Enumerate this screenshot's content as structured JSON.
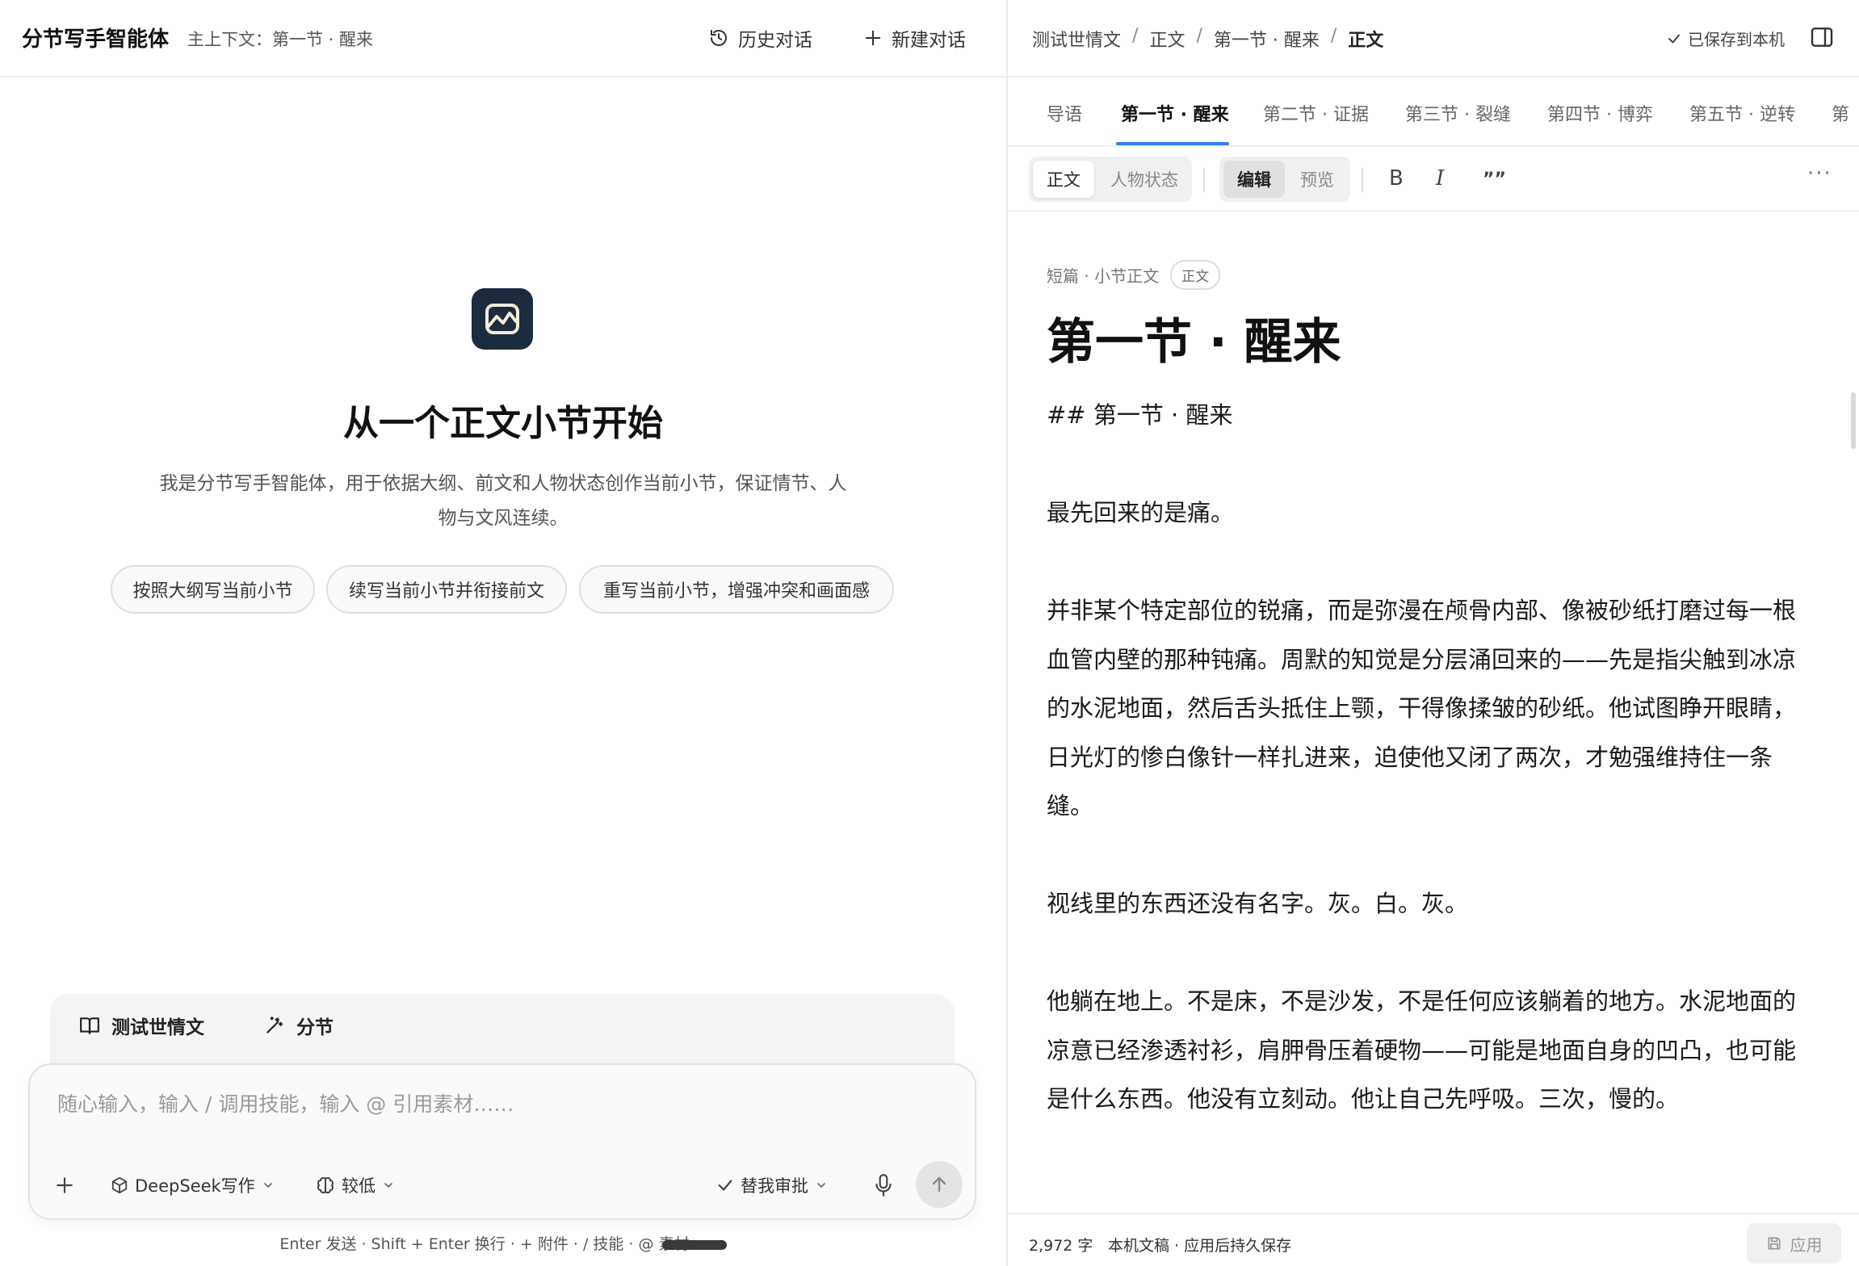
{
  "left_header": {
    "title": "分节写手智能体",
    "context": "主上下文：第一节 · 醒来",
    "history_label": "历史对话",
    "new_chat_label": "新建对话"
  },
  "hero": {
    "title": "从一个正文小节开始",
    "description": "我是分节写手智能体，用于依据大纲、前文和人物状态创作当前小节，保证情节、人物与文风连续。",
    "chips": [
      "按照大纲写当前小节",
      "续写当前小节并衔接前文",
      "重写当前小节，增强冲突和画面感"
    ]
  },
  "context_bar": {
    "book": "测试世情文",
    "mode": "分节"
  },
  "composer": {
    "placeholder": "随心输入，输入 / 调用技能，输入 @ 引用素材……",
    "model": "DeepSeek写作",
    "level": "较低",
    "approval": "替我审批"
  },
  "shortcut_hint": "Enter 发送 · Shift + Enter 换行 · + 附件 · / 技能 · @ 素材",
  "right_header": {
    "breadcrumb": [
      "测试世情文",
      "正文",
      "第一节 · 醒来",
      "正文"
    ],
    "saved_label": "已保存到本机"
  },
  "tabs": [
    "导语",
    "第一节 · 醒来",
    "第二节 · 证据",
    "第三节 · 裂缝",
    "第四节 · 博弈",
    "第五节 · 逆转",
    "第"
  ],
  "toolbar": {
    "view_main": "正文",
    "view_character": "人物状态",
    "mode_edit": "编辑",
    "mode_preview": "预览",
    "bold": "B",
    "italic": "I",
    "quote": "””",
    "more": "···"
  },
  "document": {
    "meta": "短篇 · 小节正文",
    "badge": "正文",
    "title": "第一节 · 醒来",
    "paragraphs": [
      "## 第一节 · 醒来",
      "最先回来的是痛。",
      "并非某个特定部位的锐痛，而是弥漫在颅骨内部、像被砂纸打磨过每一根血管内壁的那种钝痛。周默的知觉是分层涌回来的——先是指尖触到冰凉的水泥地面，然后舌头抵住上颚，干得像揉皱的砂纸。他试图睁开眼睛，日光灯的惨白像针一样扎进来，迫使他又闭了两次，才勉强维持住一条缝。",
      "视线里的东西还没有名字。灰。白。灰。",
      "他躺在地上。不是床，不是沙发，不是任何应该躺着的地方。水泥地面的凉意已经渗透衬衫，肩胛骨压着硬物——可能是地面自身的凹凸，也可能是什么东西。他没有立刻动。他让自己先呼吸。三次，慢的。"
    ]
  },
  "footer": {
    "word_count": "2,972 字",
    "status": "本机文稿 · 应用后持久保存",
    "apply_label": "应用"
  }
}
